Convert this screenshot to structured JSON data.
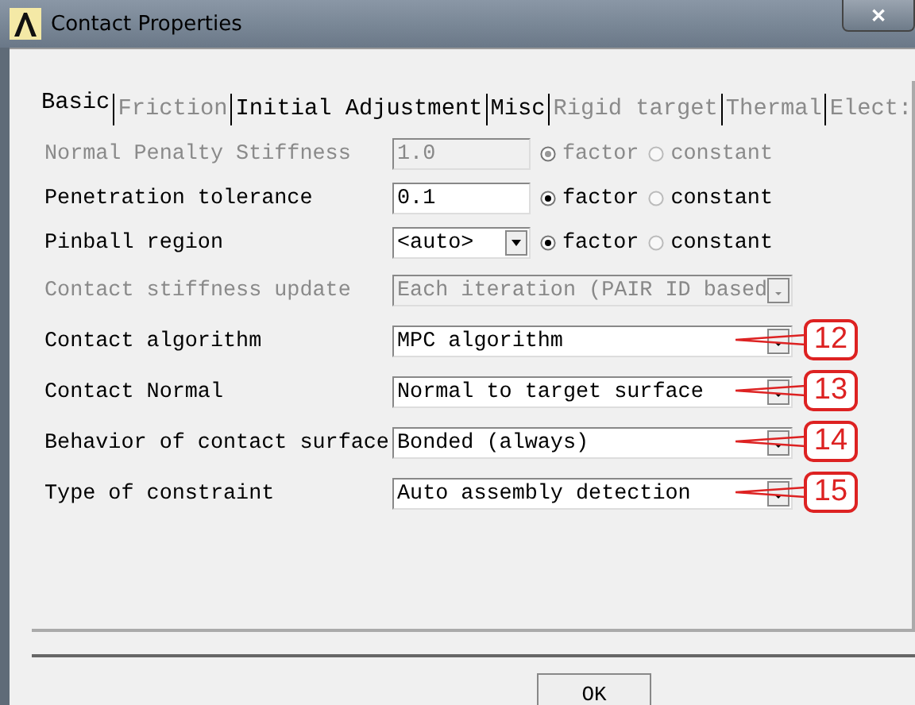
{
  "window": {
    "title": "Contact Properties",
    "close": "✕"
  },
  "tabs": [
    {
      "label": "Basic",
      "selected": true,
      "disabled": false
    },
    {
      "label": "Friction",
      "selected": false,
      "disabled": true
    },
    {
      "label": "Initial Adjustment",
      "selected": false,
      "disabled": false
    },
    {
      "label": "Misc",
      "selected": false,
      "disabled": false
    },
    {
      "label": "Rigid target",
      "selected": false,
      "disabled": true
    },
    {
      "label": "Thermal",
      "selected": false,
      "disabled": true
    },
    {
      "label": "Elect:",
      "selected": false,
      "disabled": true
    }
  ],
  "rows": [
    {
      "kind": "input",
      "label": "Normal Penalty Stiffness",
      "value": "1.0",
      "disabled": true,
      "radios": [
        {
          "label": "factor",
          "selected": true
        },
        {
          "label": "constant",
          "selected": false
        }
      ]
    },
    {
      "kind": "input",
      "label": "Penetration tolerance",
      "value": "0.1",
      "disabled": false,
      "radios": [
        {
          "label": "factor",
          "selected": true
        },
        {
          "label": "constant",
          "selected": false
        }
      ]
    },
    {
      "kind": "combo",
      "label": "Pinball region",
      "value": "<auto>",
      "disabled": false,
      "radios": [
        {
          "label": "factor",
          "selected": true
        },
        {
          "label": "constant",
          "selected": false
        }
      ]
    },
    {
      "kind": "select",
      "label": "Contact stiffness update",
      "value": "Each iteration (PAIR ID based",
      "disabled": true
    },
    {
      "kind": "select",
      "label": "Contact algorithm",
      "value": "MPC algorithm",
      "disabled": false,
      "callout": "12"
    },
    {
      "kind": "select",
      "label": "Contact Normal",
      "value": "Normal to target surface",
      "disabled": false,
      "callout": "13"
    },
    {
      "kind": "select",
      "label": "Behavior of contact surface",
      "value": "Bonded (always)",
      "disabled": false,
      "callout": "14"
    },
    {
      "kind": "select",
      "label": "Type of constraint",
      "value": "Auto assembly detection",
      "disabled": false,
      "callout": "15"
    }
  ],
  "buttons": [
    "OK"
  ]
}
